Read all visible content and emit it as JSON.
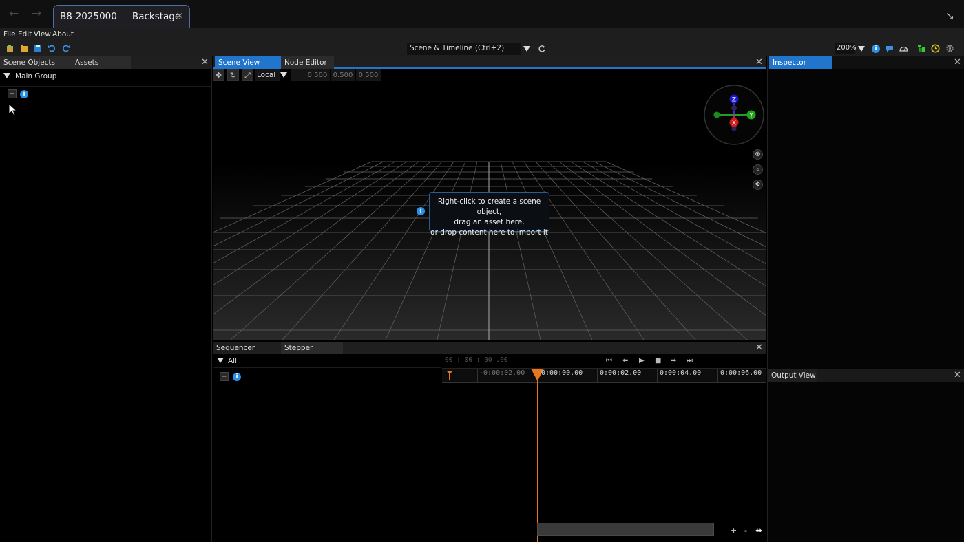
{
  "window": {
    "tab_title": "B8-2025000 — Backstage",
    "back_arrow": "←",
    "forward_arrow": "→",
    "close_glyph": "×",
    "corner_icon": "↘"
  },
  "menu": [
    "File",
    "Edit",
    "View",
    "About"
  ],
  "toolbar": {
    "icons": [
      "new-scene-icon",
      "open-icon",
      "save-icon",
      "undo-icon",
      "redo-icon"
    ],
    "layout_select": "Scene & Timeline  (Ctrl+2)",
    "zoom": "200%",
    "right_icons": [
      "info-icon",
      "chat-icon",
      "gauge-icon",
      "tree-icon",
      "clock-icon",
      "gear-icon"
    ]
  },
  "left_panel": {
    "tabs": [
      "Scene Objects",
      "Assets"
    ],
    "group": "Main Group",
    "add_label": "+",
    "info_label": "i"
  },
  "center": {
    "tabs": [
      "Scene View",
      "Node Editor"
    ],
    "space": "Local",
    "scale_values": [
      "0.500",
      "0.500",
      "0.500"
    ],
    "hint_lines": [
      "Right-click to create a scene object,",
      "drag an asset here,",
      "or drop content here to import it"
    ],
    "gizmo": {
      "z": "Z",
      "y": "Y",
      "x": "X"
    }
  },
  "sequencer": {
    "tabs": [
      "Sequencer",
      "Stepper"
    ],
    "group": "All",
    "timecode": "00 : 00 : 00  .00",
    "ruler_labels": [
      "-0:00:02.00",
      "0:00:00.00",
      "0:00:02.00",
      "0:00:04.00",
      "0:00:06.00"
    ],
    "transport": [
      "⏮",
      "⬅",
      "▶",
      "■",
      "➡",
      "⏭"
    ],
    "zoom_in": "+",
    "zoom_out": "-",
    "fit": "⬌"
  },
  "inspector": {
    "title": "Inspector"
  },
  "output": {
    "title": "Output View"
  },
  "colors": {
    "accent": "#2275cc",
    "playhead": "#e8771e",
    "info": "#2b8fe6"
  }
}
